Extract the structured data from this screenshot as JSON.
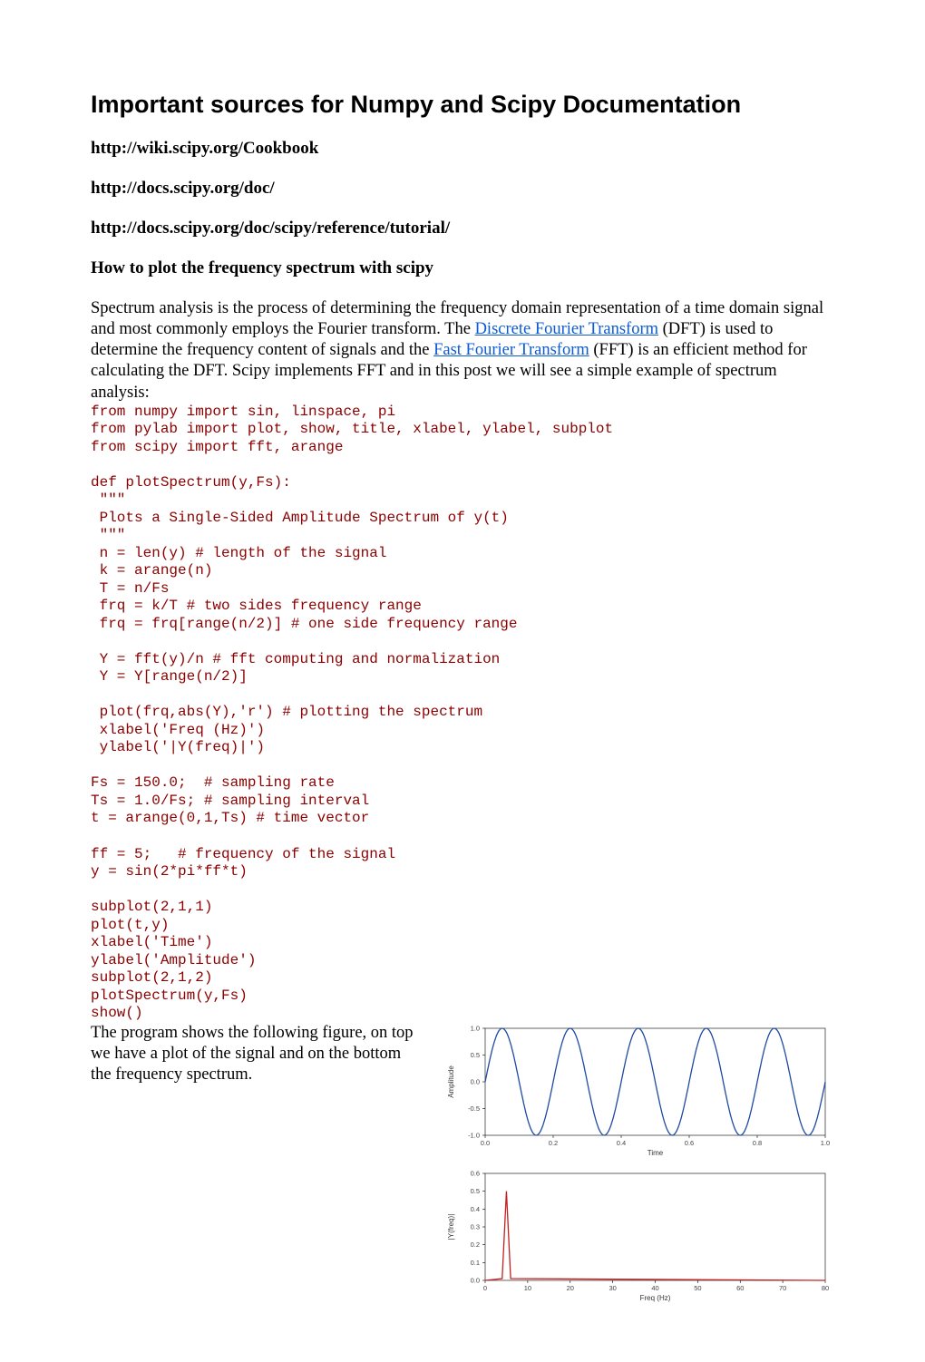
{
  "title": "Important sources for Numpy and Scipy Documentation",
  "links": {
    "l1": "http://wiki.scipy.org/Cookbook",
    "l2": "http://docs.scipy.org/doc/",
    "l3": "http://docs.scipy.org/doc/scipy/reference/tutorial/"
  },
  "section_title": "How to plot the frequency spectrum with scipy",
  "intro": {
    "p1a": "Spectrum analysis is the process of determining the frequency domain representation of a time domain signal and most commonly employs the Fourier transform. The ",
    "link_dft": "Discrete Fourier Transform",
    "p1b": " (DFT) is used to determine the frequency content of signals and the ",
    "link_fft": "Fast Fourier Transform",
    "p1c": " (FFT) is an efficient method for calculating the DFT. Scipy implements FFT and in this post we will see a simple example of spectrum analysis:"
  },
  "code_block1": "from numpy import sin, linspace, pi\nfrom pylab import plot, show, title, xlabel, ylabel, subplot\nfrom scipy import fft, arange\n\ndef plotSpectrum(y,Fs):\n \"\"\"\n Plots a Single-Sided Amplitude Spectrum of y(t)\n \"\"\"\n n = len(y) # length of the signal\n k = arange(n)\n T = n/Fs\n frq = k/T # two sides frequency range\n frq = frq[range(n/2)] # one side frequency range\n\n Y = fft(y)/n # fft computing and normalization\n Y = Y[range(n/2)]\n\n plot(frq,abs(Y),'r') # plotting the spectrum\n xlabel('Freq (Hz)')\n ylabel('|Y(freq)|')\n\nFs = 150.0;  # sampling rate\nTs = 1.0/Fs; # sampling interval\nt = arange(0,1,Ts) # time vector\n\nff = 5;   # frequency of the signal\ny = sin(2*pi*ff*t)\n\nsubplot(2,1,1)\nplot(t,y)\nxlabel('Time')\nylabel('Amplitude')\nsubplot(2,1,2)\nplotSpectrum(y,Fs)\nshow()",
  "closing": "The program shows the following figure, on top we have a plot of the signal and on the bottom the frequency spectrum.",
  "chart_data": [
    {
      "type": "line",
      "series": [
        {
          "name": "y",
          "expr": "sin(2*pi*5*t)"
        }
      ],
      "xlabel": "Time",
      "ylabel": "Amplitude",
      "xlim": [
        0.0,
        1.0
      ],
      "ylim": [
        -1.0,
        1.0
      ],
      "xticks": [
        0.0,
        0.2,
        0.4,
        0.6,
        0.8,
        1.0
      ],
      "yticks": [
        -1.0,
        -0.5,
        0.0,
        0.5,
        1.0
      ]
    },
    {
      "type": "line",
      "series": [
        {
          "name": "|Y(freq)|",
          "peak_x": 5,
          "peak_y": 0.5
        }
      ],
      "xlabel": "Freq (Hz)",
      "ylabel": "|Y(freq)|",
      "xlim": [
        0,
        80
      ],
      "ylim": [
        0.0,
        0.6
      ],
      "xticks": [
        0,
        10,
        20,
        30,
        40,
        50,
        60,
        70,
        80
      ],
      "yticks": [
        0.0,
        0.1,
        0.2,
        0.3,
        0.4,
        0.5,
        0.6
      ]
    }
  ]
}
